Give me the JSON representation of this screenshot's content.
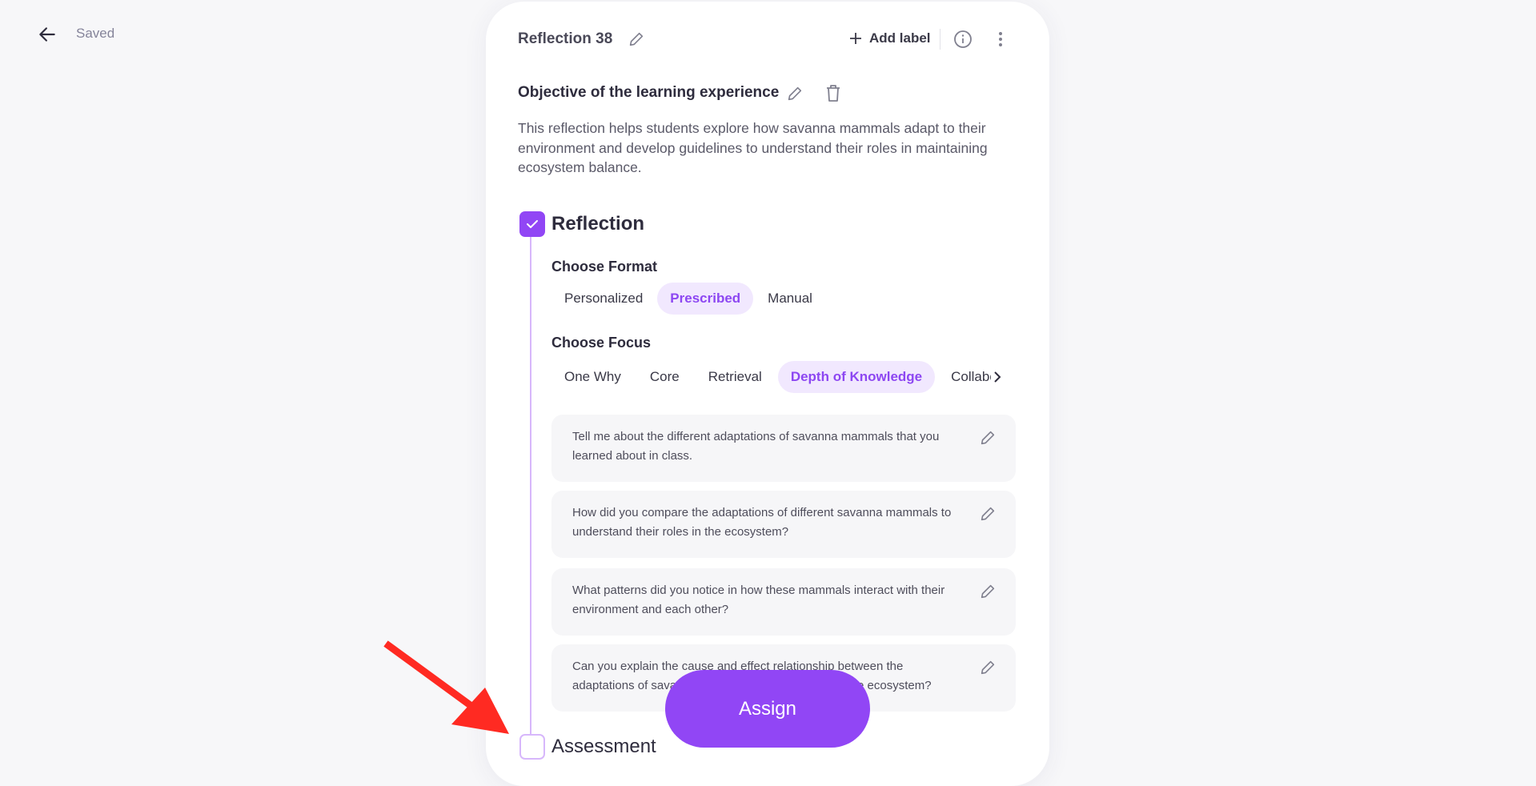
{
  "topbar": {
    "status": "Saved"
  },
  "header": {
    "title": "Reflection 38",
    "add_label": "Add label"
  },
  "objective": {
    "heading": "Objective of the learning experience",
    "text": "This reflection helps students explore how savanna mammals adapt to their environment and develop guidelines to understand their roles in maintaining ecosystem balance."
  },
  "reflection": {
    "title": "Reflection",
    "checked": true,
    "format": {
      "label": "Choose Format",
      "options": [
        "Personalized",
        "Prescribed",
        "Manual"
      ],
      "selected": "Prescribed"
    },
    "focus": {
      "label": "Choose Focus",
      "options": [
        "One Why",
        "Core",
        "Retrieval",
        "Depth of Knowledge",
        "Collabora"
      ],
      "selected": "Depth of Knowledge"
    },
    "questions": [
      "Tell me about the different adaptations of savanna mammals that you learned about in class.",
      "How did you compare the adaptations of different savanna mammals to understand their roles in the ecosystem?",
      "What patterns did you notice in how these mammals interact with their environment and each other?",
      "Can you explain the cause and effect relationship between the adaptations of savanna mammals and their roles in the ecosystem?"
    ]
  },
  "assessment": {
    "title": "Assessment",
    "checked": false
  },
  "assign_label": "Assign",
  "colors": {
    "accent": "#9146f5",
    "accent_light": "#f1e8fe",
    "annotation_arrow": "#ff2a22"
  }
}
